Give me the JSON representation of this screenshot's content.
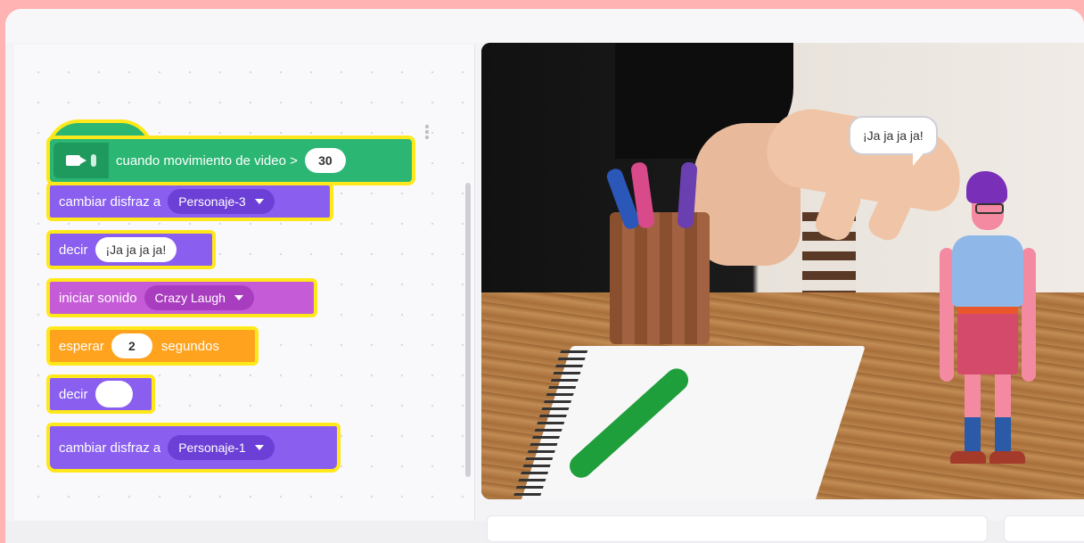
{
  "script": {
    "hat": {
      "label": "cuando movimiento de video >",
      "value": "30"
    },
    "blocks": [
      {
        "label": "cambiar disfraz a",
        "dropdown": "Personaje-3"
      },
      {
        "label": "decir",
        "text": "¡Ja ja ja ja!"
      },
      {
        "label": "iniciar sonido",
        "dropdown": "Crazy Laugh"
      },
      {
        "label": "esperar",
        "value": "2",
        "suffix": "segundos"
      },
      {
        "label": "decir",
        "text": ""
      },
      {
        "label": "cambiar disfraz a",
        "dropdown": "Personaje-1"
      }
    ]
  },
  "stage": {
    "speech": "¡Ja ja ja ja!"
  },
  "icons": {
    "hat_extension": "video-sensing-icon"
  },
  "colors": {
    "events_green": "#2bb673",
    "looks_purple": "#8a5ff0",
    "sound_pink": "#c65bd8",
    "control_orange": "#ffa31f",
    "highlight_yellow": "#ffe81a"
  }
}
